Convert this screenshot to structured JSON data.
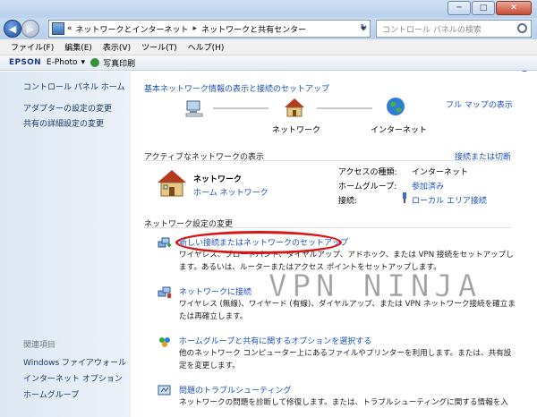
{
  "window": {
    "title_buttons": {
      "minimize": "─",
      "maximize": "□",
      "close": "✕"
    }
  },
  "address_bar": {
    "back": "◀",
    "forward": "▶",
    "prefix": "«",
    "crumb1": "ネットワークとインターネット",
    "separator": "▸",
    "crumb2": "ネットワークと共有センター",
    "refresh": "↻",
    "search_placeholder": "コントロール パネルの検索"
  },
  "menubar": [
    "ファイル(F)",
    "編集(E)",
    "表示(V)",
    "ツール(T)",
    "ヘルプ(H)"
  ],
  "epson_toolbar": {
    "brand": "EPSON",
    "product": "E-Photo",
    "dropdown": "▾",
    "print_label": "写真印刷"
  },
  "sidebar": {
    "items": [
      "コントロール パネル ホーム",
      "アダプターの設定の変更",
      "共有の詳細設定の変更"
    ],
    "related_heading": "関連項目",
    "related": [
      "Windows ファイアウォール",
      "インターネット オプション",
      "ホームグループ"
    ]
  },
  "main": {
    "map_title": "基本ネットワーク情報の表示と接続のセットアップ",
    "full_map": "フル マップの表示",
    "map_labels": {
      "network": "ネットワーク",
      "internet": "インターネット"
    },
    "active_title": "アクティブなネットワークの表示",
    "connect_disconnect": "接続または切断",
    "network_name": "ネットワーク",
    "network_type": "ホーム ネットワーク",
    "access_type_label": "アクセスの種類:",
    "access_type_value": "インターネット",
    "homegroup_label": "ホームグループ:",
    "homegroup_value": "参加済み",
    "connections_label": "接続:",
    "connections_value": "ローカル エリア接続",
    "change_title": "ネットワーク設定の変更",
    "tasks": [
      {
        "title": "新しい接続またはネットワークのセットアップ",
        "desc": "ワイヤレス、ブロードバンド、ダイヤルアップ、アドホック、または VPN 接続をセットアップします。あるいは、ルーターまたはアクセス ポイントをセットアップします。"
      },
      {
        "title": "ネットワークに接続",
        "desc": "ワイヤレス (無線)、ワイヤード (有線)、ダイヤルアップ、または VPN ネットワーク接続を確立または再確立します。"
      },
      {
        "title": "ホームグループと共有に関するオプションを選択する",
        "desc": "他のネットワーク コンピューター上にあるファイルやプリンターを利用します。または、共有設定を変更します。"
      },
      {
        "title": "問題のトラブルシューティング",
        "desc": "ネットワークの問題を診断して修復します。または、トラブルシューティングに関する情報を入"
      }
    ]
  },
  "watermark": "VPN NINJA",
  "help_label": "?",
  "colors": {
    "link": "#1a4fc2",
    "annotation": "#d81414"
  }
}
